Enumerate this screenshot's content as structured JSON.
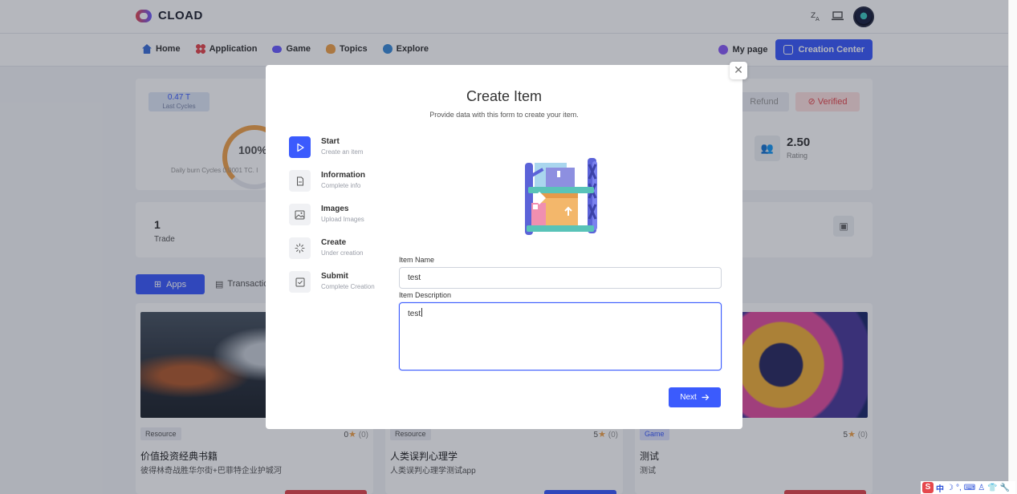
{
  "app": {
    "brand": "CLOAD"
  },
  "nav": {
    "items": [
      {
        "label": "Home",
        "icon": "home-icon",
        "color": "#3b6fd8"
      },
      {
        "label": "Application",
        "icon": "apps-grid-icon",
        "color": "#e5484d"
      },
      {
        "label": "Game",
        "icon": "gamepad-icon",
        "color": "#6a5cff"
      },
      {
        "label": "Topics",
        "icon": "bulb-icon",
        "color": "#f0a24a"
      },
      {
        "label": "Explore",
        "icon": "compass-icon",
        "color": "#3b8bd8"
      }
    ],
    "my_page": "My page",
    "creation_center": "Creation Center"
  },
  "stats": {
    "cycles_value": "0.47 T",
    "cycles_label": "Last Cycles",
    "gauge_value": "100%",
    "gauge_fraction": 1.0,
    "daily_burn": "Daily burn Cycles 0.0001 TC. I",
    "refund_label": "Refund",
    "verified_label": "Verified",
    "rating_value": "2.50",
    "rating_label": "Rating",
    "trade_count": "1",
    "trade_label": "Trade"
  },
  "tabs": {
    "apps": "Apps",
    "transactions": "Transactio"
  },
  "app_cards": [
    {
      "tag": "Resource",
      "rating": "0",
      "reviews": "(0)",
      "title": "价值投资经典书籍",
      "subtitle": "彼得林奇战胜华尔街+巴菲特企业护城河",
      "bottom_color": "#e5484d"
    },
    {
      "tag": "Resource",
      "rating": "5",
      "reviews": "(0)",
      "title": "人类误判心理学",
      "subtitle": "人类误判心理学测试app",
      "bottom_color": "#3b5bfd"
    },
    {
      "tag": "Game",
      "rating": "5",
      "reviews": "(0)",
      "title": "测试",
      "subtitle": "测试",
      "bottom_color": "#e5484d"
    }
  ],
  "modal": {
    "title": "Create Item",
    "subtitle": "Provide data with this form to create your item.",
    "close_icon": "close-icon",
    "steps": [
      {
        "name": "Start",
        "desc": "Create an item",
        "icon": "play-icon",
        "active": true
      },
      {
        "name": "Information",
        "desc": "Complete info",
        "icon": "document-icon",
        "active": false
      },
      {
        "name": "Images",
        "desc": "Upload Images",
        "icon": "image-icon",
        "active": false
      },
      {
        "name": "Create",
        "desc": "Under creation",
        "icon": "loader-icon",
        "active": false
      },
      {
        "name": "Submit",
        "desc": "Complete Creation",
        "icon": "checkbox-icon",
        "active": false
      }
    ],
    "item_name_label": "Item Name",
    "item_name_value": "test",
    "item_desc_label": "Item Description",
    "item_desc_value": "test",
    "next_label": "Next"
  },
  "ime": {
    "mode": "中"
  },
  "colors": {
    "accent": "#3b5bfd",
    "danger": "#e5484d",
    "warning": "#f0a24a"
  }
}
